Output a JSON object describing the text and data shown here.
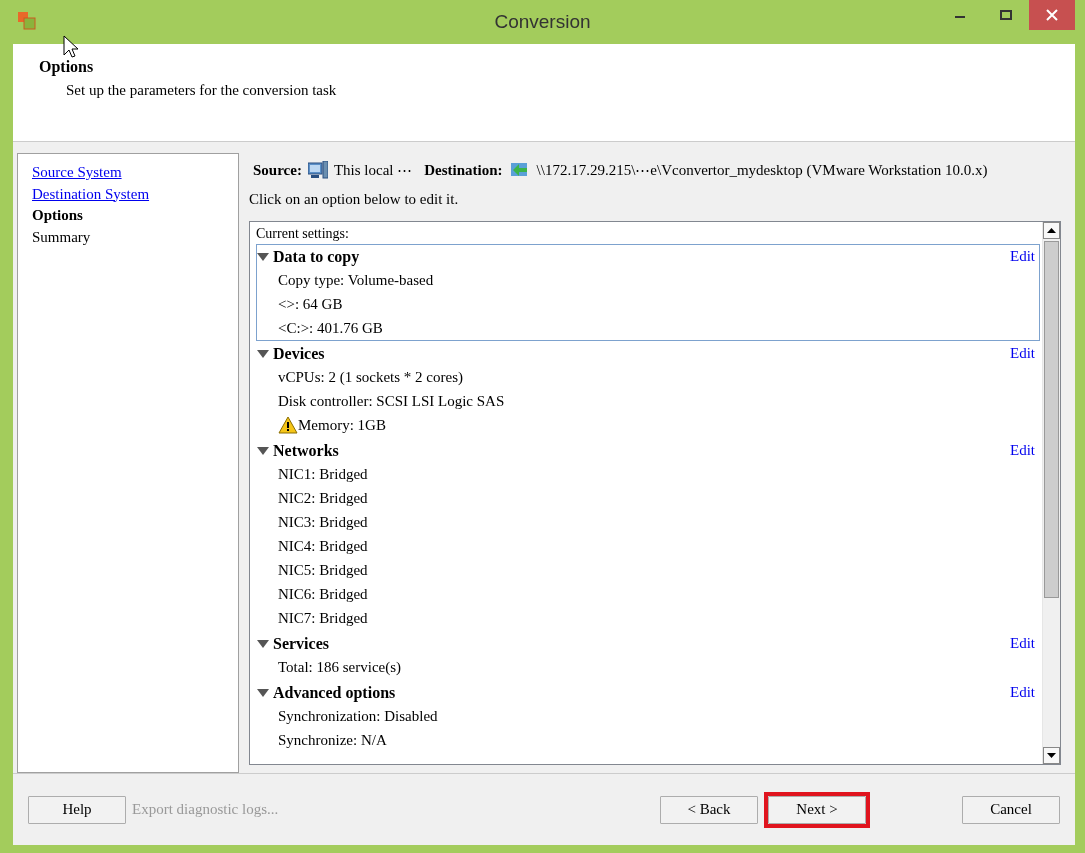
{
  "window": {
    "title": "Conversion"
  },
  "header": {
    "title": "Options",
    "subtitle": "Set up the parameters for the conversion task"
  },
  "nav": [
    {
      "label": "Source System",
      "kind": "link",
      "selected": false
    },
    {
      "label": "Destination System",
      "kind": "link",
      "selected": false
    },
    {
      "label": "Options",
      "kind": "plain",
      "selected": true
    },
    {
      "label": "Summary",
      "kind": "plain",
      "selected": false
    }
  ],
  "summary": {
    "source_label": "Source:",
    "source": "This local ⋯",
    "destination_label": "Destination:",
    "destination": "\\\\172.17.29.215\\⋯e\\Vconvertor_mydesktop (VMware Workstation 10.0.x)"
  },
  "hint": "Click on an option below to edit it.",
  "settings": {
    "caption": "Current settings:",
    "sections": [
      {
        "title": "Data to copy",
        "edit": "Edit",
        "selected": true,
        "expanded": true,
        "items": [
          {
            "text": "Copy type: Volume-based",
            "kind": "plain"
          },
          {
            "text": "<>: 64 GB",
            "kind": "plain"
          },
          {
            "text": "<C:>: 401.76 GB",
            "kind": "plain"
          }
        ]
      },
      {
        "title": "Devices",
        "edit": "Edit",
        "selected": false,
        "expanded": true,
        "items": [
          {
            "text": "vCPUs: 2 (1 sockets * 2 cores)",
            "kind": "plain"
          },
          {
            "text": "Disk controller: SCSI LSI Logic SAS",
            "kind": "plain"
          },
          {
            "text": "Memory: 1GB",
            "kind": "warning"
          }
        ]
      },
      {
        "title": "Networks",
        "edit": "Edit",
        "selected": false,
        "expanded": true,
        "items": [
          {
            "text": "NIC1: Bridged",
            "kind": "plain"
          },
          {
            "text": "NIC2: Bridged",
            "kind": "plain"
          },
          {
            "text": "NIC3: Bridged",
            "kind": "plain"
          },
          {
            "text": "NIC4: Bridged",
            "kind": "plain"
          },
          {
            "text": "NIC5: Bridged",
            "kind": "plain"
          },
          {
            "text": "NIC6: Bridged",
            "kind": "plain"
          },
          {
            "text": "NIC7: Bridged",
            "kind": "plain"
          }
        ]
      },
      {
        "title": "Services",
        "edit": "Edit",
        "selected": false,
        "expanded": true,
        "items": [
          {
            "text": "Total: 186 service(s)",
            "kind": "plain"
          }
        ]
      },
      {
        "title": "Advanced options",
        "edit": "Edit",
        "selected": false,
        "expanded": true,
        "items": [
          {
            "text": "Synchronization: Disabled",
            "kind": "plain"
          },
          {
            "text": "Synchronize: N/A",
            "kind": "plain"
          }
        ]
      }
    ]
  },
  "footer": {
    "help": "Help",
    "export": {
      "label": "Export diagnostic logs...",
      "disabled": true
    },
    "back": "< Back",
    "next": {
      "label": "Next >",
      "highlighted": true
    },
    "cancel": "Cancel"
  }
}
